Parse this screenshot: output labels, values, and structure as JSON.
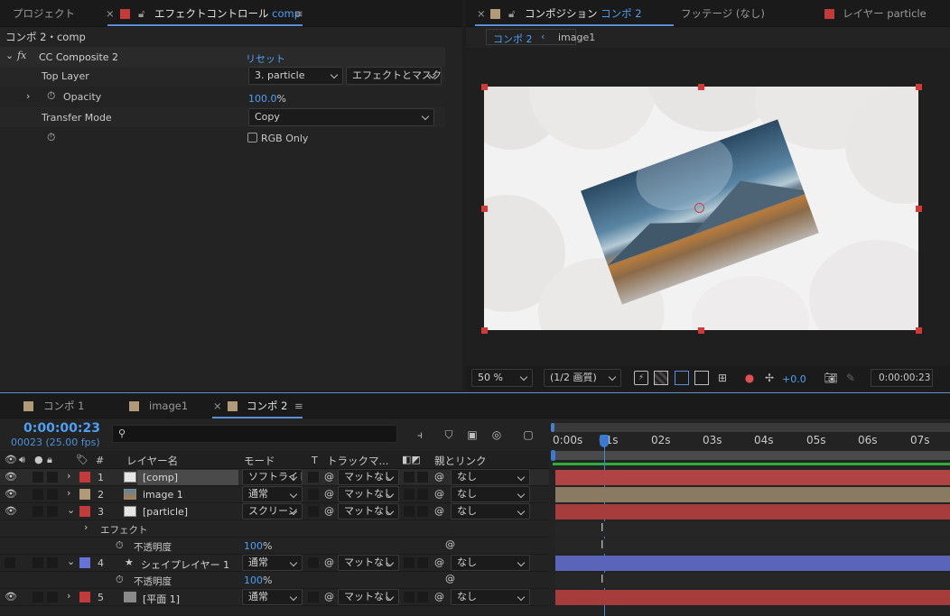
{
  "effect_controls": {
    "tabs": [
      {
        "label": "プロジェクト"
      },
      {
        "label": "エフェクトコントロール",
        "suffix": "comp"
      }
    ],
    "title": "コンポ 2・comp",
    "fx": "fx",
    "effect_name": "CC Composite 2",
    "reset": "リセット",
    "top_layer_label": "Top Layer",
    "top_layer_value": "3. particle",
    "top_layer_source": "エフェクトとマスク",
    "opacity_label": "Opacity",
    "opacity_value": "100.0",
    "opacity_unit": "%",
    "transfer_label": "Transfer Mode",
    "transfer_value": "Copy",
    "rgb_only": "RGB Only"
  },
  "composition": {
    "tabs": [
      {
        "label": "コンポジション",
        "suffix": "コンポ 2"
      },
      {
        "label": "フッテージ (なし)"
      },
      {
        "label": "レイヤー particle"
      }
    ],
    "breadcrumbs": [
      "コンポ 2",
      "image1"
    ],
    "zoom": "50 %",
    "quality": "(1/2 画質)",
    "exposure": "+0.0",
    "timecode": "0:00:00:23"
  },
  "timeline": {
    "tabs": [
      {
        "label": "コンポ 1"
      },
      {
        "label": "image1"
      },
      {
        "label": "コンポ 2"
      }
    ],
    "current_time": "0:00:00:23",
    "frames": "00023 (25.00 fps)",
    "search_placeholder": "",
    "headers": {
      "num": "#",
      "name": "レイヤー名",
      "mode": "モード",
      "t": "T",
      "track": "トラックマ...",
      "parent": "親とリンク"
    },
    "ruler": [
      "0:00s",
      "01s",
      "02s",
      "03s",
      "04s",
      "05s",
      "06s",
      "07s"
    ],
    "layers": [
      {
        "num": "1",
        "name": "[comp]",
        "mode": "ソフトライト",
        "track": "マットなし",
        "parent": "なし",
        "color": "#c23a3a"
      },
      {
        "num": "2",
        "name": "image 1",
        "mode": "通常",
        "track": "マットなし",
        "parent": "なし",
        "color": "#b09a78"
      },
      {
        "num": "3",
        "name": "[particle]",
        "mode": "スクリーン",
        "track": "マットなし",
        "parent": "なし",
        "color": "#c23a3a"
      },
      {
        "num": "4",
        "name": "シェイプレイヤー 1",
        "mode": "通常",
        "track": "マットなし",
        "parent": "なし",
        "color": "#6674d6"
      },
      {
        "num": "5",
        "name": "[平面 1]",
        "mode": "通常",
        "track": "マットなし",
        "parent": "なし",
        "color": "#c23a3a"
      }
    ],
    "effect_group": "エフェクト",
    "opacity_label": "不透明度",
    "opacity_value": "100",
    "opacity_unit": "%"
  }
}
